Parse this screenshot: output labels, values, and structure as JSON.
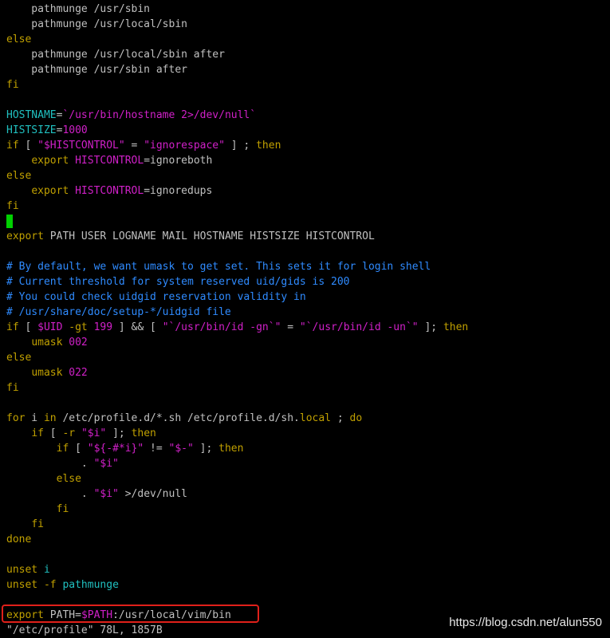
{
  "terminal": {
    "lines": [
      [
        {
          "t": "    pathmunge /usr/sbin",
          "c": "plain"
        }
      ],
      [
        {
          "t": "    pathmunge /usr/local/sbin",
          "c": "plain"
        }
      ],
      [
        {
          "t": "else",
          "c": "kw"
        }
      ],
      [
        {
          "t": "    pathmunge /usr/local/sbin after",
          "c": "plain"
        }
      ],
      [
        {
          "t": "    pathmunge /usr/sbin after",
          "c": "plain"
        }
      ],
      [
        {
          "t": "fi",
          "c": "kw"
        }
      ],
      [],
      [
        {
          "t": "HOSTNAME",
          "c": "cyan"
        },
        {
          "t": "=",
          "c": "plain"
        },
        {
          "t": "`/usr/bin/hostname 2>/dev/null`",
          "c": "str"
        }
      ],
      [
        {
          "t": "HISTSIZE",
          "c": "cyan"
        },
        {
          "t": "=",
          "c": "plain"
        },
        {
          "t": "1000",
          "c": "num"
        }
      ],
      [
        {
          "t": "if",
          "c": "kw"
        },
        {
          "t": " [ ",
          "c": "plain"
        },
        {
          "t": "\"$HISTCONTROL\"",
          "c": "str"
        },
        {
          "t": " = ",
          "c": "plain"
        },
        {
          "t": "\"ignorespace\"",
          "c": "str"
        },
        {
          "t": " ] ; ",
          "c": "plain"
        },
        {
          "t": "then",
          "c": "kw"
        }
      ],
      [
        {
          "t": "    ",
          "c": "plain"
        },
        {
          "t": "export",
          "c": "kw"
        },
        {
          "t": " ",
          "c": "plain"
        },
        {
          "t": "HISTCONTROL",
          "c": "var"
        },
        {
          "t": "=ignoreboth",
          "c": "plain"
        }
      ],
      [
        {
          "t": "else",
          "c": "kw"
        }
      ],
      [
        {
          "t": "    ",
          "c": "plain"
        },
        {
          "t": "export",
          "c": "kw"
        },
        {
          "t": " ",
          "c": "plain"
        },
        {
          "t": "HISTCONTROL",
          "c": "var"
        },
        {
          "t": "=ignoredups",
          "c": "plain"
        }
      ],
      [
        {
          "t": "fi",
          "c": "kw"
        }
      ],
      [
        {
          "t": "",
          "c": "cursor"
        }
      ],
      [
        {
          "t": "export",
          "c": "kw"
        },
        {
          "t": " PATH USER LOGNAME MAIL HOSTNAME HISTSIZE HISTCONTROL",
          "c": "plain"
        }
      ],
      [],
      [
        {
          "t": "# By default, we want umask to get set. This sets it for login shell",
          "c": "comment"
        }
      ],
      [
        {
          "t": "# Current threshold for system reserved uid/gids is 200",
          "c": "comment"
        }
      ],
      [
        {
          "t": "# You could check uidgid reservation validity in",
          "c": "comment"
        }
      ],
      [
        {
          "t": "# /usr/share/doc/setup-*/uidgid file",
          "c": "comment"
        }
      ],
      [
        {
          "t": "if",
          "c": "kw"
        },
        {
          "t": " [ ",
          "c": "plain"
        },
        {
          "t": "$UID",
          "c": "var"
        },
        {
          "t": " ",
          "c": "plain"
        },
        {
          "t": "-gt",
          "c": "kw"
        },
        {
          "t": " ",
          "c": "plain"
        },
        {
          "t": "199",
          "c": "num"
        },
        {
          "t": " ] && [ ",
          "c": "plain"
        },
        {
          "t": "\"`/usr/bin/id -gn`\"",
          "c": "str"
        },
        {
          "t": " = ",
          "c": "plain"
        },
        {
          "t": "\"`/usr/bin/id -un`\"",
          "c": "str"
        },
        {
          "t": " ]; ",
          "c": "plain"
        },
        {
          "t": "then",
          "c": "kw"
        }
      ],
      [
        {
          "t": "    ",
          "c": "plain"
        },
        {
          "t": "umask",
          "c": "kw"
        },
        {
          "t": " ",
          "c": "plain"
        },
        {
          "t": "002",
          "c": "num"
        }
      ],
      [
        {
          "t": "else",
          "c": "kw"
        }
      ],
      [
        {
          "t": "    ",
          "c": "plain"
        },
        {
          "t": "umask",
          "c": "kw"
        },
        {
          "t": " ",
          "c": "plain"
        },
        {
          "t": "022",
          "c": "num"
        }
      ],
      [
        {
          "t": "fi",
          "c": "kw"
        }
      ],
      [],
      [
        {
          "t": "for",
          "c": "kw"
        },
        {
          "t": " i ",
          "c": "plain"
        },
        {
          "t": "in",
          "c": "kw"
        },
        {
          "t": " /etc/profile.d/*.sh /etc/profile.d/sh.",
          "c": "plain"
        },
        {
          "t": "local",
          "c": "kw"
        },
        {
          "t": " ; ",
          "c": "plain"
        },
        {
          "t": "do",
          "c": "kw"
        }
      ],
      [
        {
          "t": "    ",
          "c": "plain"
        },
        {
          "t": "if",
          "c": "kw"
        },
        {
          "t": " [ ",
          "c": "plain"
        },
        {
          "t": "-r",
          "c": "kw"
        },
        {
          "t": " ",
          "c": "plain"
        },
        {
          "t": "\"$i\"",
          "c": "str"
        },
        {
          "t": " ]; ",
          "c": "plain"
        },
        {
          "t": "then",
          "c": "kw"
        }
      ],
      [
        {
          "t": "        ",
          "c": "plain"
        },
        {
          "t": "if",
          "c": "kw"
        },
        {
          "t": " [ ",
          "c": "plain"
        },
        {
          "t": "\"${-#*i}\"",
          "c": "str"
        },
        {
          "t": " != ",
          "c": "plain"
        },
        {
          "t": "\"$-\"",
          "c": "str"
        },
        {
          "t": " ]; ",
          "c": "plain"
        },
        {
          "t": "then",
          "c": "kw"
        }
      ],
      [
        {
          "t": "            . ",
          "c": "plain"
        },
        {
          "t": "\"$i\"",
          "c": "str"
        }
      ],
      [
        {
          "t": "        ",
          "c": "plain"
        },
        {
          "t": "else",
          "c": "kw"
        }
      ],
      [
        {
          "t": "            . ",
          "c": "plain"
        },
        {
          "t": "\"$i\"",
          "c": "str"
        },
        {
          "t": " >/dev/null",
          "c": "plain"
        }
      ],
      [
        {
          "t": "        ",
          "c": "plain"
        },
        {
          "t": "fi",
          "c": "kw"
        }
      ],
      [
        {
          "t": "    ",
          "c": "plain"
        },
        {
          "t": "fi",
          "c": "kw"
        }
      ],
      [
        {
          "t": "done",
          "c": "kw"
        }
      ],
      [],
      [
        {
          "t": "unset",
          "c": "kw"
        },
        {
          "t": " ",
          "c": "plain"
        },
        {
          "t": "i",
          "c": "cyan"
        }
      ],
      [
        {
          "t": "unset",
          "c": "kw"
        },
        {
          "t": " ",
          "c": "plain"
        },
        {
          "t": "-f",
          "c": "kw"
        },
        {
          "t": " ",
          "c": "plain"
        },
        {
          "t": "pathmunge",
          "c": "cyan"
        }
      ],
      [],
      [
        {
          "t": "export",
          "c": "kw"
        },
        {
          "t": " PATH=",
          "c": "plain"
        },
        {
          "t": "$PATH",
          "c": "var"
        },
        {
          "t": ":/usr/local/vim/bin",
          "c": "plain"
        }
      ],
      [
        {
          "t": "\"/etc/profile\" 78L, 1857B",
          "c": "plain"
        }
      ]
    ]
  },
  "watermark": {
    "text": "https://blog.csdn.net/alun550"
  },
  "colors": {
    "background": "#000000",
    "keyword": "#c0a000",
    "variable": "#d020c8",
    "comment": "#2f8bff",
    "identifier": "#20c0c0",
    "plain": "#c0c0c0",
    "cursor": "#00d000",
    "highlight_border": "#e0201a"
  }
}
